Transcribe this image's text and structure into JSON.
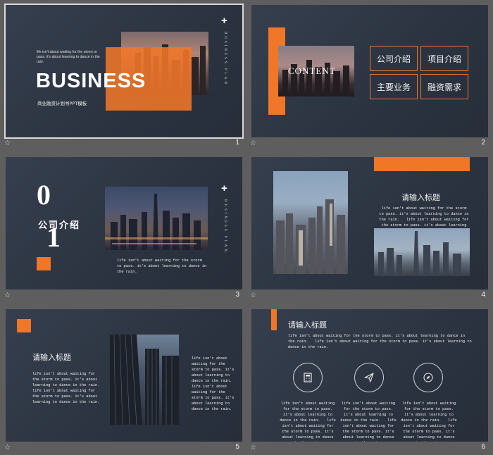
{
  "slides": [
    {
      "number": "1",
      "quote": "life isn't about waiting for the storm to pass. it's about learning to dance in the rain.",
      "title": "BUSINESS",
      "subtitle": "商业融资计划书PPT模板",
      "vertical": "BUSINESS PLAN",
      "plus": "+"
    },
    {
      "number": "2",
      "center_label": "CONTENT",
      "menu": [
        "公司介绍",
        "项目介绍",
        "主要业务",
        "融资需求"
      ]
    },
    {
      "number": "3",
      "big_num_top": "0",
      "big_num_bottom": "1",
      "heading": "公司介绍",
      "vertical": "BUSINESS PLAN",
      "plus": "+",
      "body": "life isn't about waiting for the storm to pass. it's about learning to dance in the rain."
    },
    {
      "number": "4",
      "heading": "请输入标题",
      "body": "life isn't about waiting for the storm to pass. it's about learning to dance in the rain.   life isn't about waiting for the storm to pass. it's about learning to dance in the rain."
    },
    {
      "number": "5",
      "heading": "请输入标题",
      "body_left": "life isn't about waiting for the storm to pass. it's about learning to dance in the rain.   life isn't about waiting for the storm to pass. it's about learning to dance in the rain.",
      "body_right": "life isn't about waiting for the storm to pass. it's about learning to dance in the rain. life isn't about waiting for the storm to pass. it's about learning to dance in the rain."
    },
    {
      "number": "6",
      "heading": "请输入标题",
      "body": "life isn't about waiting for the storm to pass. it's about learning to dance in the rain.   life isn't about waiting for the storm to pass. it's about learning to dance in the rain.",
      "columns": [
        {
          "icon": "calculator-icon",
          "text": "life isn't about waiting for the storm to pass. it's about learning to dance in the rain.   life isn't about waiting for the storm to pass. it's about learning to dance in the rain."
        },
        {
          "icon": "paper-plane-icon",
          "text": "life isn't about waiting for the storm to pass. it's about learning to dance in the rain.   life isn't about waiting for the storm to pass. it's about learning to dance in the rain."
        },
        {
          "icon": "compass-icon",
          "text": "life isn't about waiting for the storm to pass. it's about learning to dance in the rain.   life isn't about waiting for the storm to pass. it's about learning to dance in the rain."
        }
      ]
    }
  ],
  "star_glyph": "☆",
  "colors": {
    "accent": "#f07628",
    "slide_bg": "#2e3644",
    "panel_bg": "#5e5e5e"
  }
}
